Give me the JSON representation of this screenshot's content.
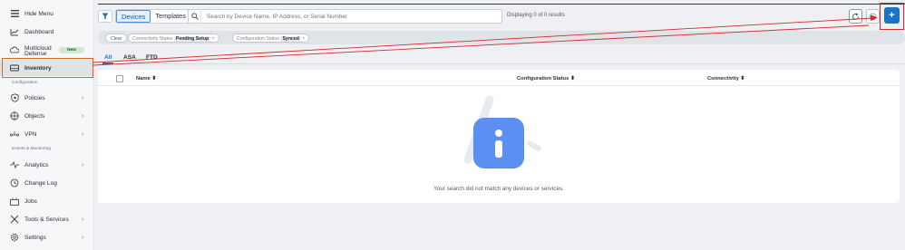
{
  "sidebar": {
    "hide_menu": "Hide Menu",
    "items": [
      {
        "label": "Dashboard"
      },
      {
        "label_line1": "Multicloud",
        "label_line2": "Defense",
        "badge": "New"
      },
      {
        "label": "Inventory"
      },
      {
        "label": "Policies"
      },
      {
        "label": "Objects"
      },
      {
        "label": "VPN"
      },
      {
        "label": "Analytics"
      },
      {
        "label": "Change Log"
      },
      {
        "label": "Jobs"
      },
      {
        "label": "Tools & Services"
      },
      {
        "label": "Settings"
      }
    ],
    "sections": {
      "configuration": "Configuration",
      "events": "Events & Monitoring"
    }
  },
  "toolbar": {
    "devices": "Devices",
    "templates": "Templates",
    "search_placeholder": "Search by Device Name, IP Address, or Serial Number",
    "display_count": "Displaying 0 of 0 results",
    "add_label": "+"
  },
  "filters": {
    "clear": "Clear",
    "chips": [
      {
        "name": "Connectivity States",
        "value": "Pending Setup"
      },
      {
        "name": "Configuration Status",
        "value": "Synced"
      }
    ]
  },
  "tabs": [
    "All",
    "ASA",
    "FTD"
  ],
  "table": {
    "columns": [
      "Name",
      "Configuration Status",
      "Connectivity"
    ],
    "empty_message": "Your search did not match any devices or services."
  },
  "colors": {
    "accent": "#1a73c8",
    "highlight_orange": "#d2691e",
    "annotation_red": "#d22b2b"
  }
}
